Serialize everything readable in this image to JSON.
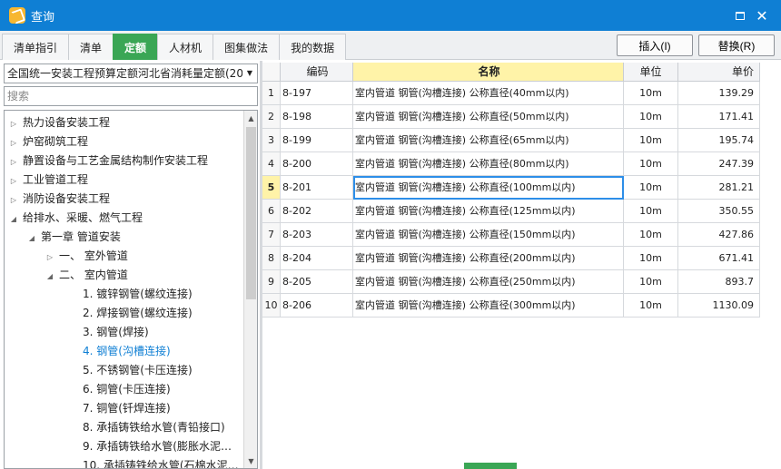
{
  "window": {
    "title": "查询"
  },
  "tabs": [
    {
      "label": "清单指引",
      "active": false
    },
    {
      "label": "清单",
      "active": false
    },
    {
      "label": "定额",
      "active": true
    },
    {
      "label": "人材机",
      "active": false
    },
    {
      "label": "图集做法",
      "active": false
    },
    {
      "label": "我的数据",
      "active": false
    }
  ],
  "actions": {
    "insert_label": "插入(I)",
    "replace_label": "替换(R)"
  },
  "left": {
    "quota_library": "全国统一安装工程预算定额河北省消耗量定额(20",
    "search_placeholder": "搜索",
    "tree": [
      {
        "label": "热力设备安装工程",
        "level": 0,
        "toggle": "▷",
        "selected": false
      },
      {
        "label": "炉窑砌筑工程",
        "level": 0,
        "toggle": "▷",
        "selected": false
      },
      {
        "label": "静置设备与工艺金属结构制作安装工程",
        "level": 0,
        "toggle": "▷",
        "selected": false
      },
      {
        "label": "工业管道工程",
        "level": 0,
        "toggle": "▷",
        "selected": false
      },
      {
        "label": "消防设备安装工程",
        "level": 0,
        "toggle": "▷",
        "selected": false
      },
      {
        "label": "给排水、采暖、燃气工程",
        "level": 0,
        "toggle": "◢",
        "selected": false
      },
      {
        "label": "第一章 管道安装",
        "level": 1,
        "toggle": "◢",
        "selected": false
      },
      {
        "label": "一、 室外管道",
        "level": 2,
        "toggle": "▷",
        "selected": false
      },
      {
        "label": "二、 室内管道",
        "level": 2,
        "toggle": "◢",
        "selected": false
      },
      {
        "label": "1. 镀锌钢管(螺纹连接)",
        "level": 3,
        "toggle": "",
        "selected": false
      },
      {
        "label": "2. 焊接钢管(螺纹连接)",
        "level": 3,
        "toggle": "",
        "selected": false
      },
      {
        "label": "3. 钢管(焊接)",
        "level": 3,
        "toggle": "",
        "selected": false
      },
      {
        "label": "4. 钢管(沟槽连接)",
        "level": 3,
        "toggle": "",
        "selected": true
      },
      {
        "label": "5. 不锈钢管(卡压连接)",
        "level": 3,
        "toggle": "",
        "selected": false
      },
      {
        "label": "6. 铜管(卡压连接)",
        "level": 3,
        "toggle": "",
        "selected": false
      },
      {
        "label": "7. 铜管(钎焊连接)",
        "level": 3,
        "toggle": "",
        "selected": false
      },
      {
        "label": "8. 承插铸铁给水管(青铅接口)",
        "level": 3,
        "toggle": "",
        "selected": false
      },
      {
        "label": "9. 承插铸铁给水管(膨胀水泥…",
        "level": 3,
        "toggle": "",
        "selected": false
      },
      {
        "label": "10. 承插铸铁给水管(石棉水泥…",
        "level": 3,
        "toggle": "",
        "selected": false
      }
    ]
  },
  "grid": {
    "headers": {
      "index": "",
      "code": "编码",
      "name": "名称",
      "unit": "单位",
      "price": "单价"
    },
    "rows": [
      {
        "index": "1",
        "code": "8-197",
        "name": "室内管道 钢管(沟槽连接) 公称直径(40mm以内)",
        "unit": "10m",
        "price": "139.29",
        "current": false
      },
      {
        "index": "2",
        "code": "8-198",
        "name": "室内管道 钢管(沟槽连接) 公称直径(50mm以内)",
        "unit": "10m",
        "price": "171.41",
        "current": false
      },
      {
        "index": "3",
        "code": "8-199",
        "name": "室内管道 钢管(沟槽连接) 公称直径(65mm以内)",
        "unit": "10m",
        "price": "195.74",
        "current": false
      },
      {
        "index": "4",
        "code": "8-200",
        "name": "室内管道 钢管(沟槽连接) 公称直径(80mm以内)",
        "unit": "10m",
        "price": "247.39",
        "current": false
      },
      {
        "index": "5",
        "code": "8-201",
        "name": "室内管道 钢管(沟槽连接) 公称直径(100mm以内)",
        "unit": "10m",
        "price": "281.21",
        "current": true
      },
      {
        "index": "6",
        "code": "8-202",
        "name": "室内管道 钢管(沟槽连接) 公称直径(125mm以内)",
        "unit": "10m",
        "price": "350.55",
        "current": false
      },
      {
        "index": "7",
        "code": "8-203",
        "name": "室内管道 钢管(沟槽连接) 公称直径(150mm以内)",
        "unit": "10m",
        "price": "427.86",
        "current": false
      },
      {
        "index": "8",
        "code": "8-204",
        "name": "室内管道 钢管(沟槽连接) 公称直径(200mm以内)",
        "unit": "10m",
        "price": "671.41",
        "current": false
      },
      {
        "index": "9",
        "code": "8-205",
        "name": "室内管道 钢管(沟槽连接) 公称直径(250mm以内)",
        "unit": "10m",
        "price": "893.7",
        "current": false
      },
      {
        "index": "10",
        "code": "8-206",
        "name": "室内管道 钢管(沟槽连接) 公称直径(300mm以内)",
        "unit": "10m",
        "price": "1130.09",
        "current": false
      }
    ]
  },
  "colors": {
    "title_bar": "#0f7fd4",
    "active_tab": "#3aa655",
    "name_header": "#fff3a8",
    "selection": "#2d8ee8"
  },
  "icons": {
    "app": "app-icon",
    "maximize": "maximize-icon",
    "close": "close-icon"
  }
}
